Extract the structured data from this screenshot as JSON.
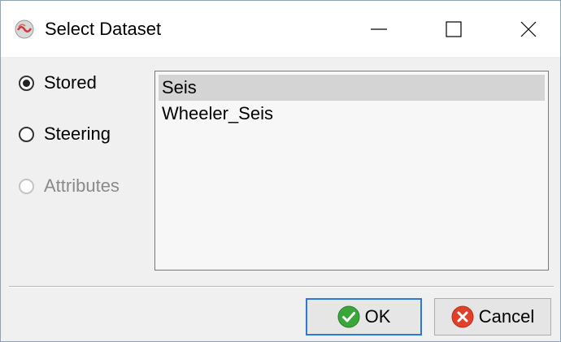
{
  "window": {
    "title": "Select Dataset",
    "app_icon": "seismic-app-icon",
    "controls": [
      "minimize-icon",
      "maximize-icon",
      "close-icon"
    ]
  },
  "source_options": [
    {
      "label": "Stored",
      "selected": true,
      "enabled": true
    },
    {
      "label": "Steering",
      "selected": false,
      "enabled": true
    },
    {
      "label": "Attributes",
      "selected": false,
      "enabled": false
    }
  ],
  "datasets": {
    "items": [
      "Seis",
      "Wheeler_Seis"
    ],
    "selected_index": 0
  },
  "buttons": {
    "ok_label": "OK",
    "ok_icon": "check-circle-icon",
    "cancel_label": "Cancel",
    "cancel_icon": "cross-circle-icon"
  },
  "colors": {
    "ok_icon": "#3aa63a",
    "cancel_icon": "#e0402a",
    "ok_focus_border": "#2b7bd6",
    "selection": "#d4d4d4"
  }
}
